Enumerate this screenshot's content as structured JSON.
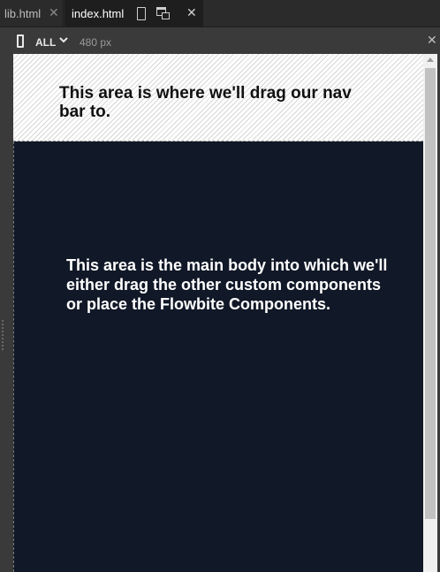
{
  "tabs": [
    {
      "label": "lib.html",
      "close_glyph": "✕",
      "active": false
    },
    {
      "label": "index.html",
      "close_glyph": "✕",
      "active": true
    }
  ],
  "tab_icons": [
    "mobile-preview-icon",
    "open-in-window-icon"
  ],
  "preview_toolbar": {
    "device_icon": "mobile-device-icon",
    "breakpoint_label": "ALL",
    "width_label": "480 px",
    "close_glyph": "✕"
  },
  "canvas": {
    "nav_placeholder_text": "This area is where we'll drag our nav bar to.",
    "main_placeholder_text": "This area is the main body into which we'll either drag the other custom components or place the Flowbite Components.",
    "main_background": "#111827"
  }
}
